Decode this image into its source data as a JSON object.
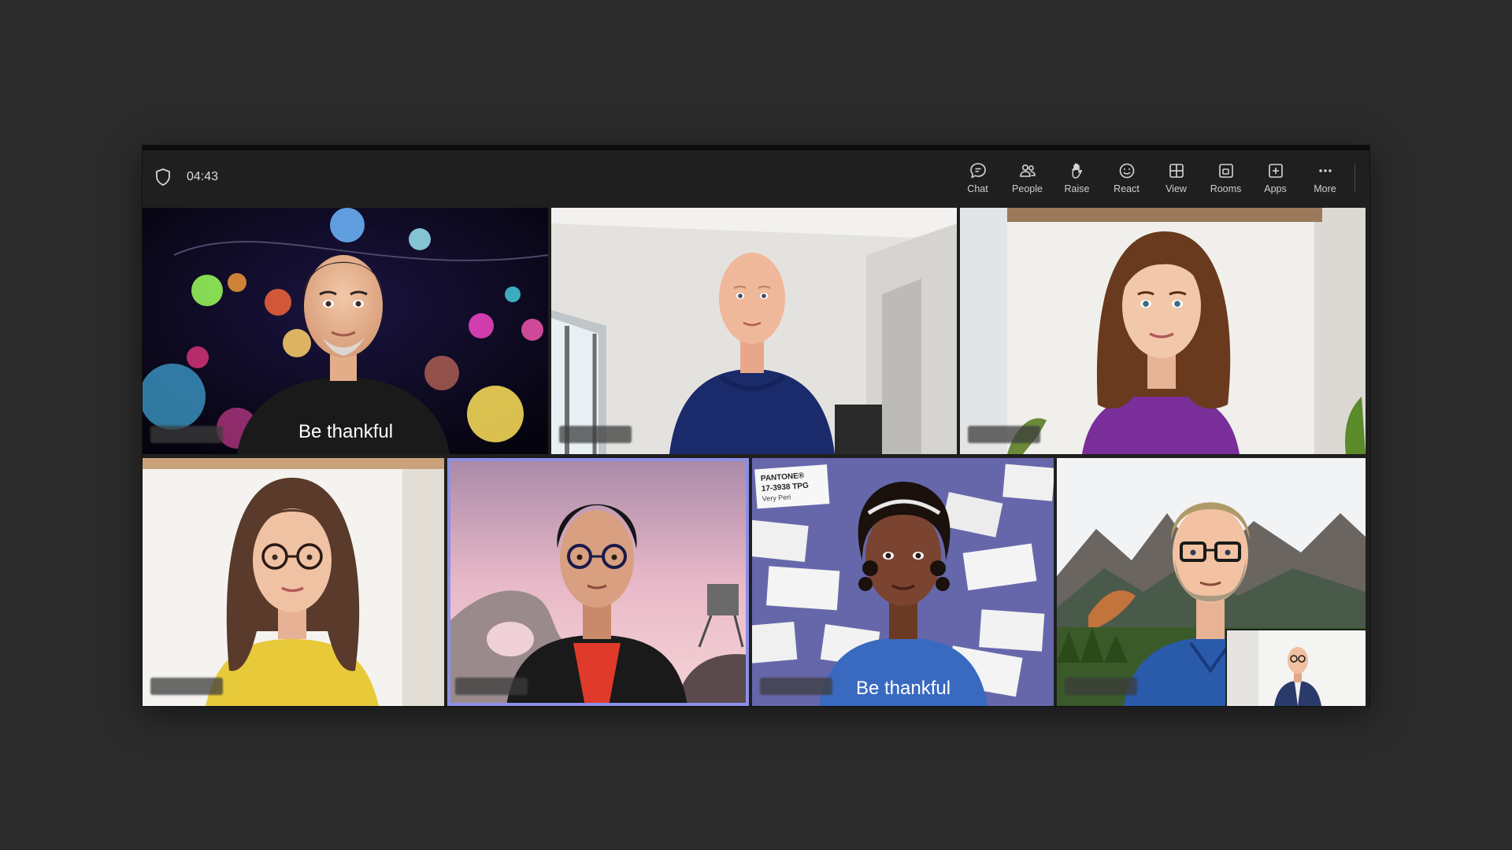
{
  "meeting": {
    "timer": "04:43",
    "toolbar": [
      {
        "id": "chat",
        "label": "Chat",
        "icon": "chat-icon"
      },
      {
        "id": "people",
        "label": "People",
        "icon": "people-icon"
      },
      {
        "id": "raise",
        "label": "Raise",
        "icon": "hand-icon"
      },
      {
        "id": "react",
        "label": "React",
        "icon": "smiley-icon"
      },
      {
        "id": "view",
        "label": "View",
        "icon": "grid-view-icon"
      },
      {
        "id": "rooms",
        "label": "Rooms",
        "icon": "rooms-icon"
      },
      {
        "id": "apps",
        "label": "Apps",
        "icon": "plus-box-icon"
      },
      {
        "id": "more",
        "label": "More",
        "icon": "ellipsis-icon"
      }
    ]
  },
  "participants": [
    {
      "shirt_text": "Be thankful"
    },
    {},
    {},
    {},
    {
      "active": true
    },
    {
      "shirt_text": "Be thankful",
      "poster_title": "PANTONE®",
      "poster_code": "17-3938 TPG",
      "poster_name": "Very Peri"
    },
    {}
  ],
  "colors": {
    "bg": "#2b2b2b",
    "window": "#1f1f1f",
    "active_border": "#8b8fe6",
    "very_peri": "#6667ab"
  }
}
